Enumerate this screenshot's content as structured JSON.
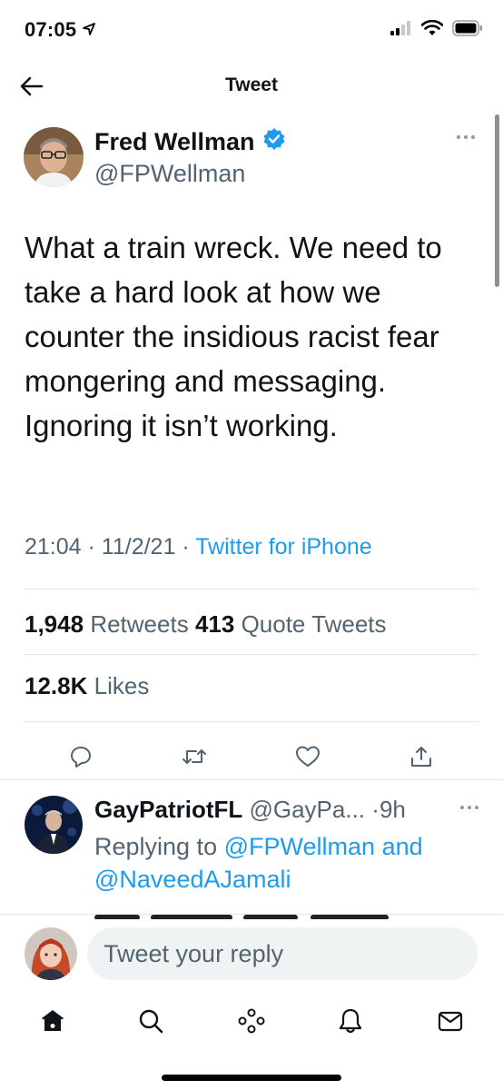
{
  "status_bar": {
    "time": "07:05",
    "location_icon": "location-arrow-icon",
    "signal_icon": "cellular-signal-icon",
    "wifi_icon": "wifi-icon",
    "battery_icon": "battery-icon"
  },
  "header": {
    "title": "Tweet",
    "back_icon": "back-arrow-icon"
  },
  "tweet": {
    "author_name": "Fred Wellman",
    "verified": true,
    "author_handle": "@FPWellman",
    "text": "What a train wreck. We need to take a hard look at how we counter the insidious racist fear mongering and messaging. Ignoring it isn’t working.",
    "time": "21:04",
    "date": "11/2/21",
    "separator": "·",
    "source": "Twitter for iPhone",
    "retweets_count": "1,948",
    "retweets_label": "Retweets",
    "quote_count": "413",
    "quote_label": "Quote Tweets",
    "likes_count": "12.8K",
    "likes_label": "Likes"
  },
  "actions": [
    "reply-icon",
    "retweet-icon",
    "like-icon",
    "share-icon"
  ],
  "reply": {
    "name": "GayPatriotFL",
    "handle": "@GayPa...",
    "separator": "·",
    "time": "9h",
    "replying_prefix": "Replying to",
    "mention1": "@FPWellman",
    "conjunction": "and",
    "mention2": "@NaveedAJamali"
  },
  "compose": {
    "placeholder": "Tweet your reply"
  },
  "tabs": [
    "home-icon",
    "search-icon",
    "spaces-icon",
    "notifications-icon",
    "messages-icon"
  ],
  "colors": {
    "accent": "#1d9bf0",
    "text": "#0f1419",
    "secondary": "#536471",
    "divider": "#e1e6ea"
  }
}
